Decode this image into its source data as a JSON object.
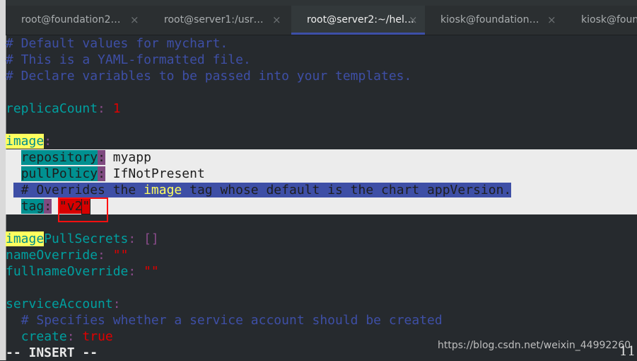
{
  "tabs": [
    {
      "label": "root@foundation2…",
      "active": false
    },
    {
      "label": "root@server1:/usr…",
      "active": false
    },
    {
      "label": "root@server2:~/hel…",
      "active": true
    },
    {
      "label": "kiosk@foundation…",
      "active": false
    },
    {
      "label": "kiosk@foun",
      "active": false
    }
  ],
  "close_glyph": "×",
  "colors": {
    "accent": "#3d4fa8",
    "comment": "#3e4fa6",
    "key": "#00a0a0",
    "value": "#e00000",
    "annotation": "#ff1010"
  },
  "lines": [
    {
      "row_style": "",
      "segs": [
        {
          "t": "# Default values for mychart.",
          "c": "comment"
        }
      ]
    },
    {
      "row_style": "",
      "segs": [
        {
          "t": "# This is a YAML-formatted file.",
          "c": "comment"
        }
      ]
    },
    {
      "row_style": "",
      "segs": [
        {
          "t": "# Declare variables to be passed into your templates.",
          "c": "comment"
        }
      ]
    },
    {
      "row_style": "",
      "segs": []
    },
    {
      "row_style": "",
      "segs": [
        {
          "t": "replicaCount",
          "c": "key"
        },
        {
          "t": ":",
          "c": "colon"
        },
        {
          "t": " ",
          "c": ""
        },
        {
          "t": "1",
          "c": "num"
        }
      ]
    },
    {
      "row_style": "",
      "segs": []
    },
    {
      "row_style": "",
      "segs": [
        {
          "t": "image",
          "c": "hl-yellow"
        },
        {
          "t": ":",
          "c": "colon"
        }
      ]
    },
    {
      "row_style": "sel",
      "segs": [
        {
          "t": "  ",
          "c": ""
        },
        {
          "t": "repository",
          "c": "key-sel"
        },
        {
          "t": ":",
          "c": "colon-sel"
        },
        {
          "t": " myapp",
          "c": ""
        }
      ]
    },
    {
      "row_style": "sel",
      "segs": [
        {
          "t": "  ",
          "c": ""
        },
        {
          "t": "pullPolicy",
          "c": "key-sel"
        },
        {
          "t": ":",
          "c": "colon-sel"
        },
        {
          "t": " IfNotPresent",
          "c": ""
        }
      ]
    },
    {
      "row_style": "sel",
      "segs": [
        {
          "t": " ",
          "c": ""
        },
        {
          "t": " # Overrides the ",
          "c": "comment-sel"
        },
        {
          "t": "image",
          "c": "comment-sel img-in-comment"
        },
        {
          "t": " tag whose default is the chart appVersion.",
          "c": "comment-sel"
        }
      ]
    },
    {
      "row_style": "sel",
      "segs": [
        {
          "t": "  ",
          "c": ""
        },
        {
          "t": "tag",
          "c": "key-sel"
        },
        {
          "t": ":",
          "c": "colon-sel"
        },
        {
          "t": " ",
          "c": ""
        },
        {
          "t": "\"v2",
          "c": "str-sel"
        },
        {
          "t": "\"",
          "c": "str-sel cursor"
        }
      ]
    },
    {
      "row_style": "",
      "segs": []
    },
    {
      "row_style": "",
      "segs": [
        {
          "t": "image",
          "c": "hl-yellow"
        },
        {
          "t": "PullSecrets",
          "c": "key"
        },
        {
          "t": ":",
          "c": "colon"
        },
        {
          "t": " ",
          "c": ""
        },
        {
          "t": "[]",
          "c": "colon"
        }
      ]
    },
    {
      "row_style": "",
      "segs": [
        {
          "t": "nameOverride",
          "c": "key"
        },
        {
          "t": ":",
          "c": "colon"
        },
        {
          "t": " ",
          "c": ""
        },
        {
          "t": "\"\"",
          "c": "num"
        }
      ]
    },
    {
      "row_style": "",
      "segs": [
        {
          "t": "fullnameOverride",
          "c": "key"
        },
        {
          "t": ":",
          "c": "colon"
        },
        {
          "t": " ",
          "c": ""
        },
        {
          "t": "\"\"",
          "c": "num"
        }
      ]
    },
    {
      "row_style": "",
      "segs": []
    },
    {
      "row_style": "",
      "segs": [
        {
          "t": "serviceAccount",
          "c": "key"
        },
        {
          "t": ":",
          "c": "colon"
        }
      ]
    },
    {
      "row_style": "",
      "segs": [
        {
          "t": "  ",
          "c": ""
        },
        {
          "t": "# Specifies whether a service account should be created",
          "c": "comment"
        }
      ]
    },
    {
      "row_style": "",
      "segs": [
        {
          "t": "  ",
          "c": ""
        },
        {
          "t": "create",
          "c": "key"
        },
        {
          "t": ":",
          "c": "colon"
        },
        {
          "t": " ",
          "c": ""
        },
        {
          "t": "true",
          "c": "num"
        }
      ]
    },
    {
      "row_style": "",
      "segs": [
        {
          "t": "-- INSERT --",
          "c": "mode"
        }
      ]
    }
  ],
  "watermark": "https://blog.csdn.net/weixin_44992260",
  "ruler": "11"
}
